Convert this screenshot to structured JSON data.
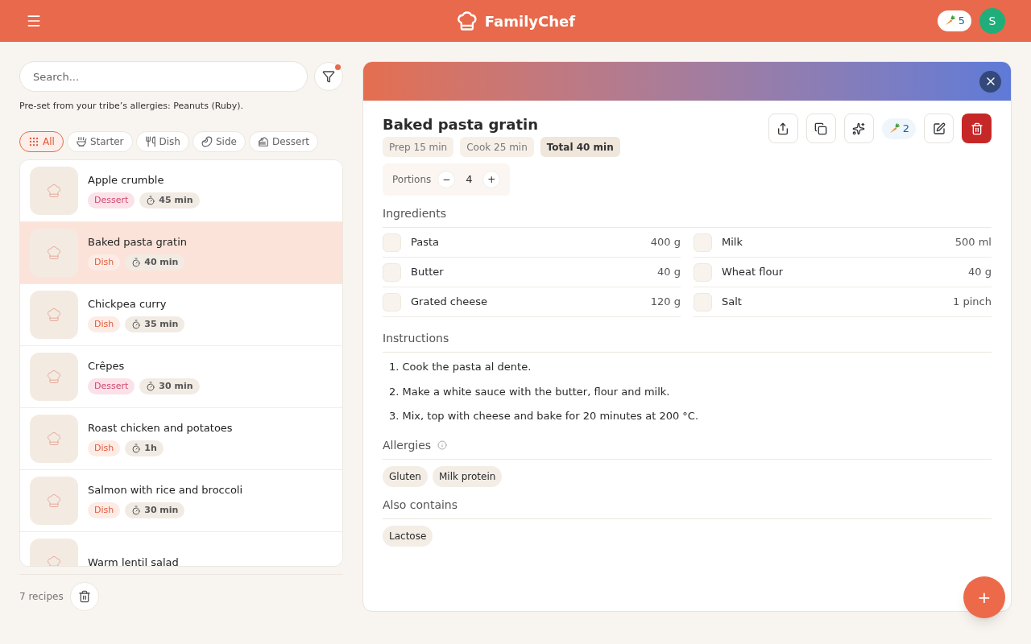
{
  "header": {
    "app_name": "FamilyChef",
    "carrots": "5",
    "avatar": "S"
  },
  "search": {
    "placeholder": "Search...",
    "filter_active": true
  },
  "allergy_note": "Pre-set from your tribe’s allergies: Peanuts (Ruby).",
  "categories": [
    {
      "kind": "all",
      "label": "All",
      "selected": true
    },
    {
      "kind": "starter",
      "label": "Starter",
      "selected": false
    },
    {
      "kind": "dish",
      "label": "Dish",
      "selected": false
    },
    {
      "kind": "side",
      "label": "Side",
      "selected": false
    },
    {
      "kind": "dessert",
      "label": "Dessert",
      "selected": false
    }
  ],
  "recipes": [
    {
      "name": "Apple crumble",
      "category": "Dessert",
      "kind": "dessert",
      "time": "45 min",
      "selected": false
    },
    {
      "name": "Baked pasta gratin",
      "category": "Dish",
      "kind": "dish",
      "time": "40 min",
      "selected": true
    },
    {
      "name": "Chickpea curry",
      "category": "Dish",
      "kind": "dish",
      "time": "35 min",
      "selected": false
    },
    {
      "name": "Crêpes",
      "category": "Dessert",
      "kind": "dessert",
      "time": "30 min",
      "selected": false
    },
    {
      "name": "Roast chicken and potatoes",
      "category": "Dish",
      "kind": "dish",
      "time": "1h",
      "selected": false
    },
    {
      "name": "Salmon with rice and broccoli",
      "category": "Dish",
      "kind": "dish",
      "time": "30 min",
      "selected": false
    },
    {
      "name": "Warm lentil salad",
      "selected": false
    }
  ],
  "recipe_count": "7 recipes",
  "detail": {
    "title": "Baked pasta gratin",
    "carrots": "2",
    "times": [
      {
        "label": "Prep 15 min",
        "emphasis": false
      },
      {
        "label": "Cook 25 min",
        "emphasis": false
      },
      {
        "label": "Total 40 min",
        "emphasis": true
      }
    ],
    "portions_label": "Portions",
    "portions": "4",
    "minus": "−",
    "plus": "+",
    "ingredients_title": "Ingredients",
    "ingredients": [
      {
        "name": "Pasta",
        "qty": "400 g",
        "checked": false
      },
      {
        "name": "Milk",
        "qty": "500 ml",
        "checked": false
      },
      {
        "name": "Butter",
        "qty": "40 g",
        "checked": false
      },
      {
        "name": "Wheat flour",
        "qty": "40 g",
        "checked": false
      },
      {
        "name": "Grated cheese",
        "qty": "120 g",
        "checked": false
      },
      {
        "name": "Salt",
        "qty": "1 pinch",
        "checked": false
      }
    ],
    "instructions_title": "Instructions",
    "instructions": [
      "1. Cook the pasta al dente.",
      "2. Make a white sauce with the butter, flour and milk.",
      "3. Mix, top with cheese and bake for 20 minutes at 200 °C."
    ],
    "allergies_title": "Allergies",
    "allergies": [
      "Gluten",
      "Milk protein"
    ],
    "also_title": "Also contains",
    "also": [
      "Lactose"
    ]
  },
  "fab": "+"
}
